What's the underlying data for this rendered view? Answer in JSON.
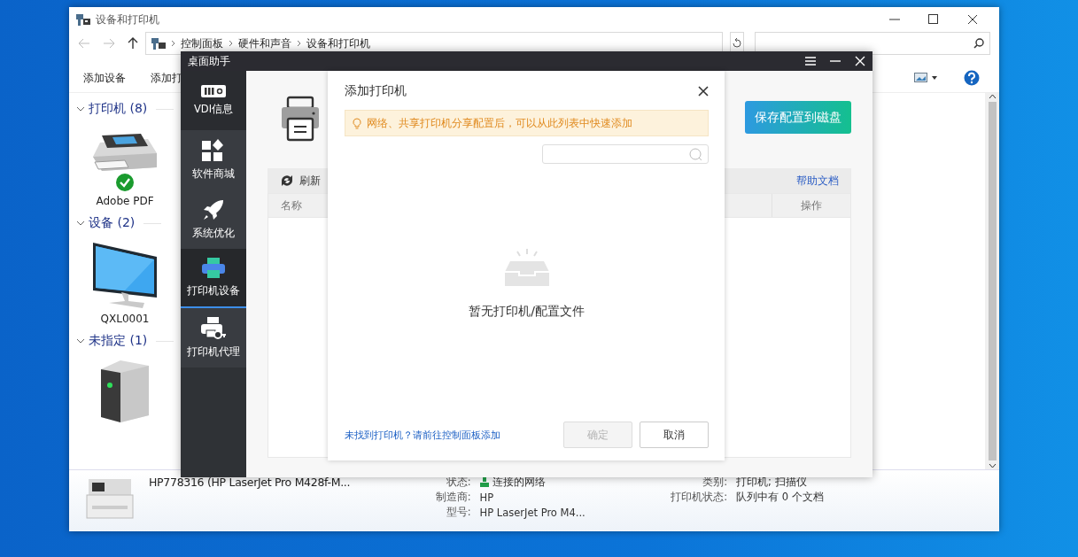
{
  "explorer": {
    "title": "设备和打印机",
    "breadcrumb": [
      "控制面板",
      "硬件和声音",
      "设备和打印机"
    ],
    "toolbar": [
      "添加设备",
      "添加打"
    ],
    "groups": [
      {
        "label": "打印机 (8)",
        "expanded": true,
        "items": [
          {
            "name": "Adobe PDF",
            "kind": "printer",
            "default": true
          }
        ]
      },
      {
        "label": "设备 (2)",
        "expanded": true,
        "items": [
          {
            "name": "QXL0001",
            "kind": "monitor",
            "default": false
          }
        ]
      },
      {
        "label": "未指定 (1)",
        "expanded": true,
        "items": [
          {
            "kind": "server",
            "default": false
          }
        ]
      }
    ],
    "details": {
      "name": "HP778316 (HP LaserJet Pro M428f-M...",
      "left_fields": [
        {
          "label": "状态:",
          "value": "连接的网络",
          "kind": "network"
        },
        {
          "label": "制造商:",
          "value": "HP",
          "kind": "text"
        },
        {
          "label": "型号:",
          "value": "HP LaserJet Pro M4...",
          "kind": "text"
        }
      ],
      "right_fields": [
        {
          "label": "类别:",
          "value": "打印机; 扫描仪"
        },
        {
          "label": "打印机状态:",
          "value": "队列中有 0 个文档"
        }
      ]
    }
  },
  "helper": {
    "title": "桌面助手",
    "nav": [
      {
        "label": "VDI信息",
        "kind": "vdi",
        "selected": false
      },
      {
        "label": "软件商城",
        "kind": "store",
        "selected": false
      },
      {
        "label": "系统优化",
        "kind": "rocket",
        "selected": false
      },
      {
        "label": "打印机设备",
        "kind": "printer",
        "selected": true
      },
      {
        "label": "打印机代理",
        "kind": "proxy",
        "selected": false
      }
    ],
    "save_button": "保存配置到磁盘",
    "refresh": "刷新",
    "help_link": "帮助文档",
    "columns": [
      "名称",
      "操作"
    ]
  },
  "dialog": {
    "title": "添加打印机",
    "notice": "网络、共享打印机分享配置后，可以从此列表中快速添加",
    "empty_text": "暂无打印机/配置文件",
    "link": "未找到打印机？请前往控制面板添加",
    "buttons": [
      {
        "label": "确定",
        "disabled": true
      },
      {
        "label": "取消",
        "disabled": false
      }
    ]
  }
}
